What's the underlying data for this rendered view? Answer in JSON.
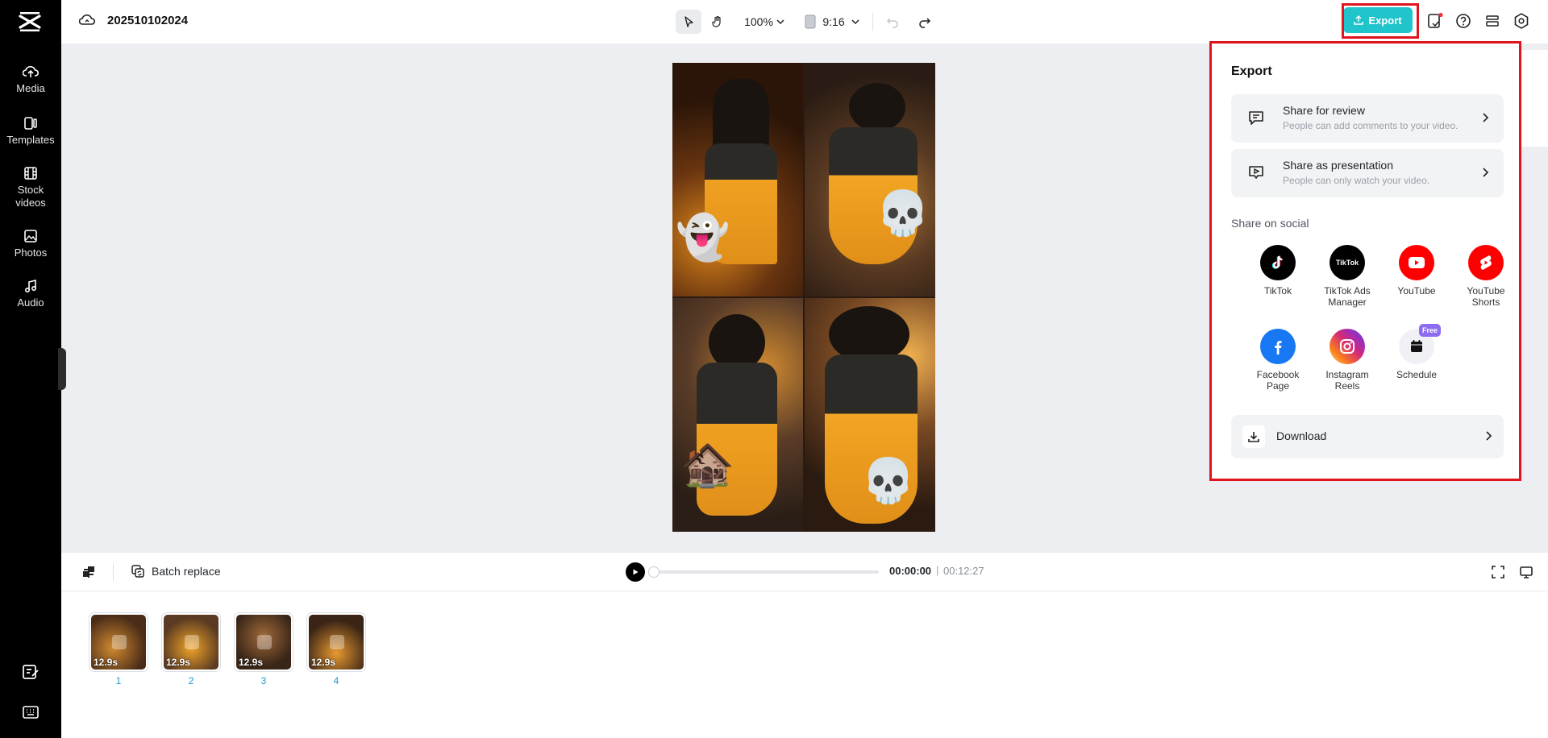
{
  "project": {
    "name": "202510102024"
  },
  "rail": {
    "items": [
      {
        "label": "Media",
        "icon": "cloud-upload-icon"
      },
      {
        "label": "Templates",
        "icon": "template-icon"
      },
      {
        "label": "Stock videos",
        "icon": "film-icon"
      },
      {
        "label": "Photos",
        "icon": "image-icon"
      },
      {
        "label": "Audio",
        "icon": "music-note-icon"
      }
    ]
  },
  "toolbar": {
    "zoom": "100%",
    "ratio": "9:16",
    "export_label": "Export"
  },
  "export_panel": {
    "title": "Export",
    "share_review": {
      "title": "Share for review",
      "subtitle": "People can add comments to your video."
    },
    "share_presentation": {
      "title": "Share as presentation",
      "subtitle": "People can only watch your video."
    },
    "social_label": "Share on social",
    "socials": [
      {
        "label": "TikTok",
        "icon": "tiktok-icon",
        "color": "#000000"
      },
      {
        "label": "TikTok Ads Manager",
        "icon": "tiktok-ads-icon",
        "color": "#000000"
      },
      {
        "label": "YouTube",
        "icon": "youtube-icon",
        "color": "#ff0000"
      },
      {
        "label": "YouTube Shorts",
        "icon": "youtube-shorts-icon",
        "color": "#ff0000"
      },
      {
        "label": "Facebook Page",
        "icon": "facebook-icon",
        "color": "#1877f2"
      },
      {
        "label": "Instagram Reels",
        "icon": "instagram-icon",
        "color": "#d6249f"
      },
      {
        "label": "Schedule",
        "icon": "calendar-icon",
        "badge": "Free"
      }
    ],
    "tiktok_ads_text": "TikTok",
    "download_label": "Download"
  },
  "player": {
    "batch_replace": "Batch replace",
    "current_time": "00:00:00",
    "separator": "|",
    "total_time": "00:12:27"
  },
  "timeline": {
    "clips": [
      {
        "duration": "12.9s",
        "number": "1"
      },
      {
        "duration": "12.9s",
        "number": "2"
      },
      {
        "duration": "12.9s",
        "number": "3"
      },
      {
        "duration": "12.9s",
        "number": "4"
      }
    ]
  },
  "colors": {
    "accent": "#20c4cb",
    "highlight": "#e0141e",
    "link": "#1a9ad6"
  }
}
